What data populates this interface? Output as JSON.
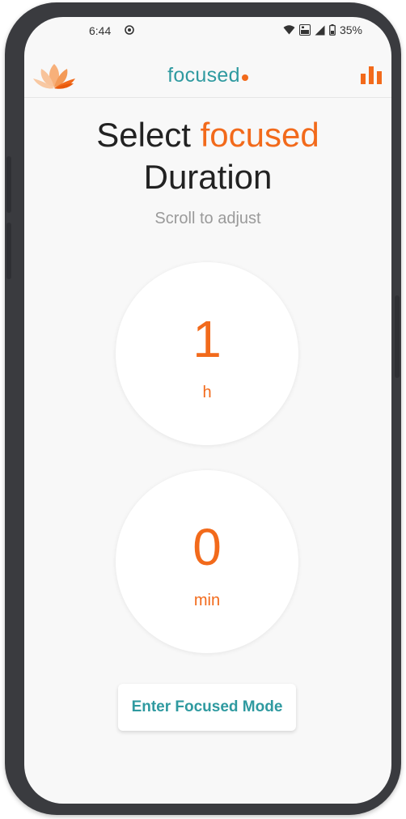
{
  "status_bar": {
    "time": "6:44",
    "battery_percent": "35%",
    "icons": [
      "app-notification-icon",
      "wifi-icon",
      "volte-icon",
      "signal-icon",
      "battery-icon"
    ]
  },
  "app_bar": {
    "brand": "focused",
    "logo_icon": "lotus-logo-icon",
    "stats_icon": "bar-chart-icon"
  },
  "heading": {
    "line1_prefix": "Select",
    "line1_accent": "focused",
    "line2": "Duration"
  },
  "subtitle": "Scroll to adjust",
  "picker": {
    "hours_value": "1",
    "hours_unit": "h",
    "minutes_value": "0",
    "minutes_unit": "min"
  },
  "cta_label": "Enter Focused Mode",
  "colors": {
    "accent": "#f26a1b",
    "brand": "#2f9aa0",
    "background": "#f8f8f8",
    "frame": "#3a3b3f"
  }
}
